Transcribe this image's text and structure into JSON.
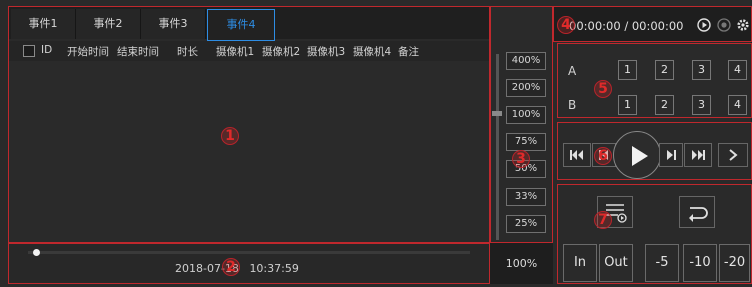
{
  "tabs": [
    {
      "label": "事件1"
    },
    {
      "label": "事件2"
    },
    {
      "label": "事件3"
    },
    {
      "label": "事件4",
      "active": true
    }
  ],
  "table_headers": [
    "ID",
    "开始时间",
    "结束时间",
    "时长",
    "摄像机1",
    "摄像机2",
    "摄像机3",
    "摄像机4",
    "备注"
  ],
  "timeline": {
    "date": "2018-07-18",
    "time": "10:37:59"
  },
  "zoom": {
    "levels": [
      "400%",
      "200%",
      "100%",
      "75%",
      "50%",
      "33%",
      "25%"
    ],
    "current": "100%"
  },
  "playback": {
    "current": "00:00:00",
    "separator": "/",
    "total": "00:00:00"
  },
  "ab": {
    "rows": [
      {
        "label": "A",
        "buttons": [
          "1",
          "2",
          "3",
          "4"
        ]
      },
      {
        "label": "B",
        "buttons": [
          "1",
          "2",
          "3",
          "4"
        ]
      }
    ]
  },
  "transport_icons": [
    "skip-start-icon",
    "step-back-icon",
    "play-icon",
    "step-forward-icon",
    "skip-end-icon",
    "next-icon"
  ],
  "bottom_buttons": [
    "In",
    "Out",
    "-5",
    "-10",
    "-20"
  ],
  "markers": [
    "1",
    "2",
    "3",
    "4",
    "5",
    "6",
    "7"
  ],
  "colors": {
    "accent": "#2e8de4",
    "marker": "#e02a2a",
    "background": "#2a2a2a"
  }
}
